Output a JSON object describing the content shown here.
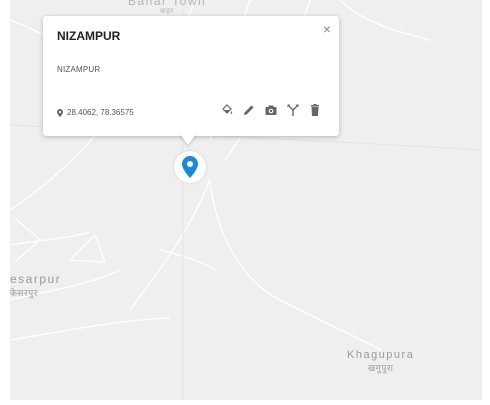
{
  "popup": {
    "title": "NIZAMPUR",
    "description": "NIZAMPUR",
    "coordinates": "28.4062, 78.36575",
    "close_symbol": "×",
    "actions": [
      "fill-color-icon",
      "edit-icon",
      "camera-icon",
      "directions-icon",
      "delete-icon"
    ]
  },
  "map": {
    "places": {
      "top": {
        "name": "Bahar Town",
        "local": "बाहर"
      },
      "left": {
        "name": "esarpur",
        "local": "केसरपुर"
      },
      "right": {
        "name": "Khagupura",
        "local": "खगुपुरा"
      }
    },
    "marker_color": "#1a8ad4"
  }
}
